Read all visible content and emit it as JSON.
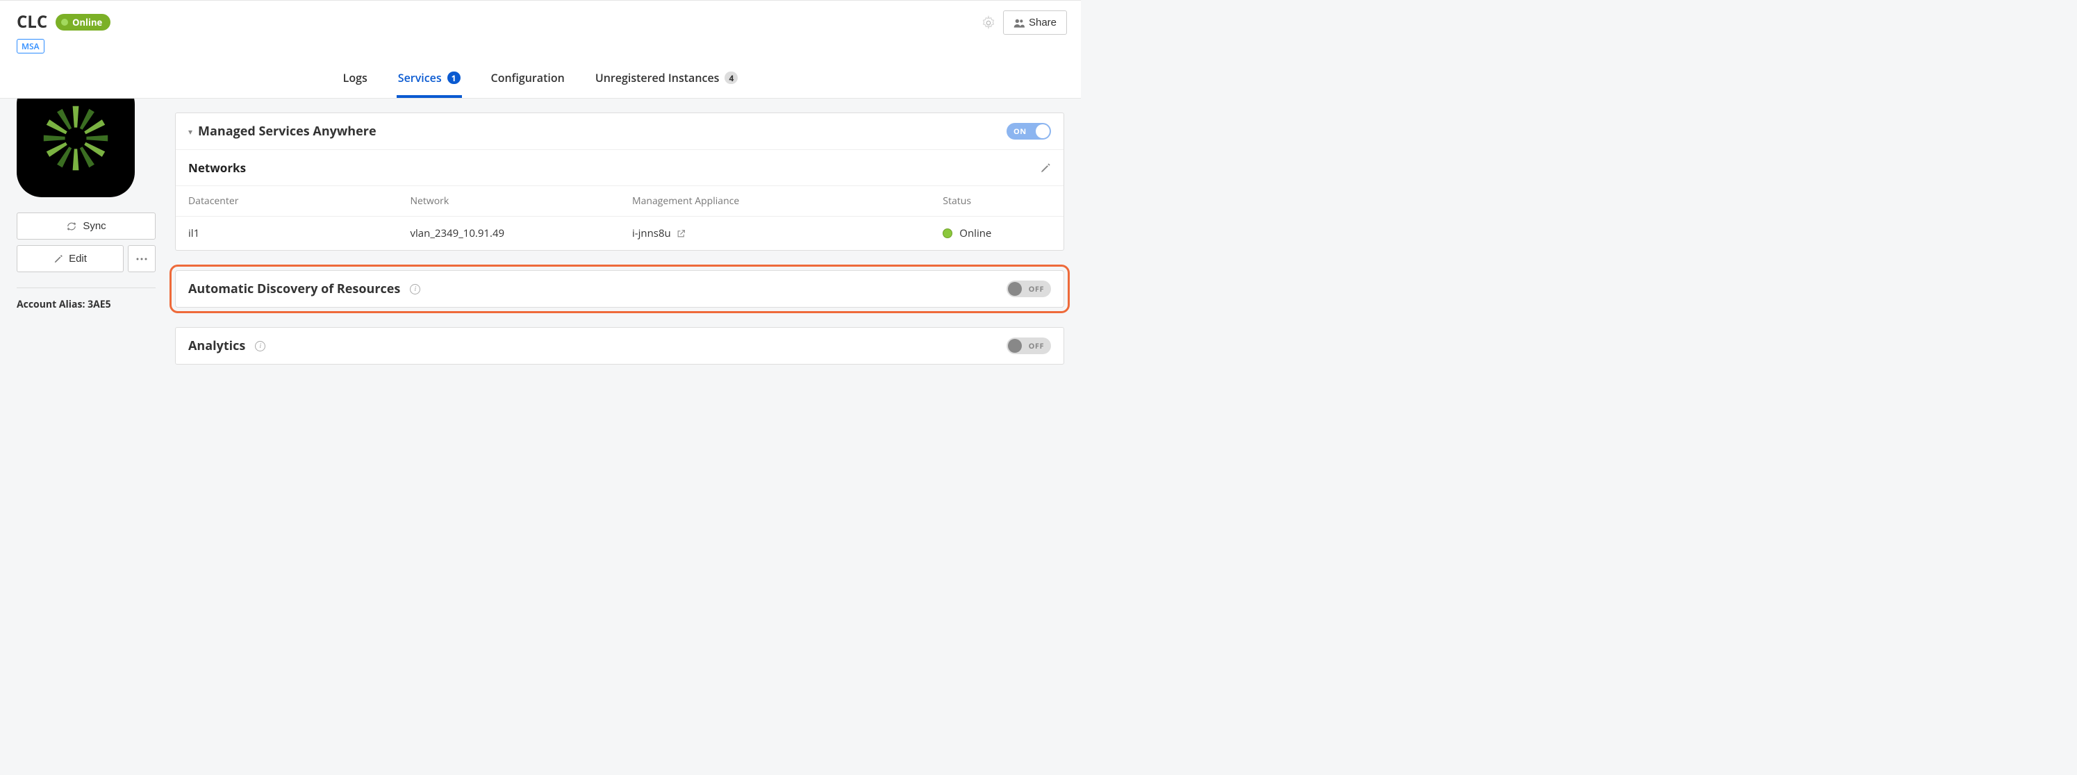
{
  "header": {
    "title": "CLC",
    "status_label": "Online",
    "msa_tag": "MSA",
    "share_label": "Share"
  },
  "tabs": {
    "logs": "Logs",
    "services": "Services",
    "services_badge": "1",
    "configuration": "Configuration",
    "unregistered": "Unregistered Instances",
    "unregistered_badge": "4"
  },
  "sidebar": {
    "sync_label": "Sync",
    "edit_label": "Edit",
    "account_alias_label": "Account Alias: 3AE5"
  },
  "panels": {
    "msa": {
      "title": "Managed Services Anywhere",
      "toggle": "ON",
      "networks_title": "Networks",
      "columns": {
        "datacenter": "Datacenter",
        "network": "Network",
        "appliance": "Management Appliance",
        "status": "Status"
      },
      "row": {
        "datacenter": "il1",
        "network": "vlan_2349_10.91.49",
        "appliance": "i-jnns8u",
        "status": "Online"
      }
    },
    "discovery": {
      "title": "Automatic Discovery of Resources",
      "toggle": "OFF"
    },
    "analytics": {
      "title": "Analytics",
      "toggle": "OFF"
    }
  }
}
